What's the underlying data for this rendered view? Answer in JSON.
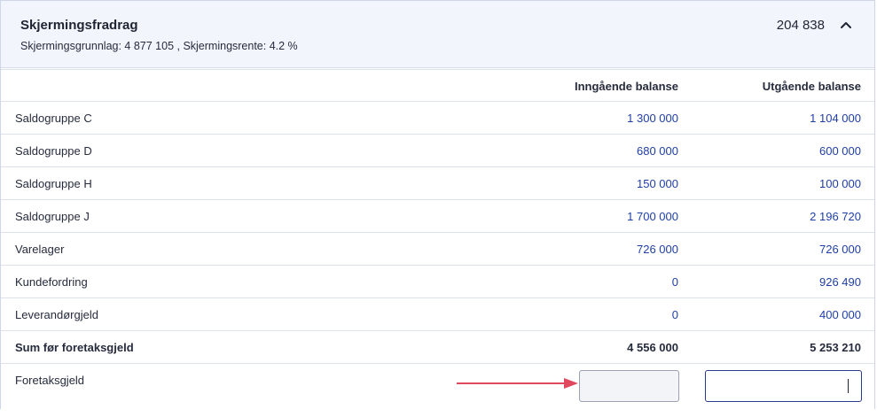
{
  "header": {
    "title": "Skjermingsfradrag",
    "subtitle": "Skjermingsgrunnlag: 4 877 105  ,  Skjermingsrente: 4.2 %",
    "total": "204 838"
  },
  "columns": {
    "opening": "Inngående balanse",
    "closing": "Utgående balanse"
  },
  "rows": [
    {
      "label": "Saldogruppe C",
      "opening": "1 300 000",
      "closing": "1 104 000"
    },
    {
      "label": "Saldogruppe D",
      "opening": "680 000",
      "closing": "600 000"
    },
    {
      "label": "Saldogruppe H",
      "opening": "150 000",
      "closing": "100 000"
    },
    {
      "label": "Saldogruppe J",
      "opening": "1 700 000",
      "closing": "2 196 720"
    },
    {
      "label": "Varelager",
      "opening": "726 000",
      "closing": "726 000"
    },
    {
      "label": "Kundefordring",
      "opening": "0",
      "closing": "926 490"
    },
    {
      "label": "Leverandørgjeld",
      "opening": "0",
      "closing": "400 000"
    }
  ],
  "sum": {
    "label": "Sum før foretaksgjeld",
    "opening": "4 556 000",
    "closing": "5 253 210"
  },
  "debt": {
    "label": "Foretaksgjeld",
    "opening_value": "",
    "closing_value": ""
  },
  "colors": {
    "accent": "#1f3fa6",
    "header_bg": "#f3f5fc",
    "arrow": "#e0485e"
  },
  "icons": {
    "collapse": "chevron-up-icon",
    "annotation": "arrow-right-icon"
  }
}
